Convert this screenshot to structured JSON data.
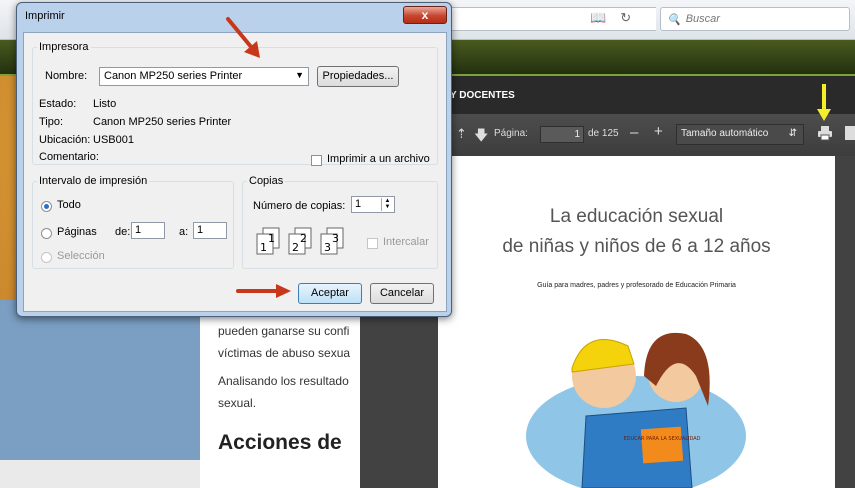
{
  "browser": {
    "search_placeholder": "Buscar"
  },
  "site": {
    "nav_text": "Y DOCENTES"
  },
  "pdf": {
    "page_label": "Página:",
    "page_value": "1",
    "page_total": "de 125",
    "zoom_label": "Tamaño automático",
    "title_line1": "La educación sexual",
    "title_line2": "de niñas y niños de 6 a 12 años",
    "subtitle": "Guía para madres, padres y profesorado de Educación Primaria",
    "book_text": "EDUCAR PARA LA SEXUALIDAD"
  },
  "article": {
    "line1": "pueden ganarse su confi",
    "line2": "víctimas de abuso sexua",
    "line3": "Analisando los resultado",
    "line4": "sexual.",
    "heading": "Acciones de"
  },
  "dialog": {
    "title": "Imprimir",
    "close_label": "x",
    "printer_group": "Impresora",
    "name_label": "Nombre:",
    "printer_name": "Canon MP250 series Printer",
    "properties_button": "Propiedades...",
    "status_label": "Estado:",
    "status_value": "Listo",
    "type_label": "Tipo:",
    "type_value": "Canon MP250 series Printer",
    "location_label": "Ubicación:",
    "location_value": "USB001",
    "comment_label": "Comentario:",
    "print_to_file": "Imprimir a un archivo",
    "range_group": "Intervalo de impresión",
    "all_option": "Todo",
    "pages_option": "Páginas",
    "from_label": "de:",
    "from_value": "1",
    "to_label": "a:",
    "to_value": "1",
    "selection_option": "Selección",
    "copies_group": "Copias",
    "copies_label": "Número de copias:",
    "copies_value": "1",
    "collate_label": "Intercalar",
    "collate_icon_digits": [
      "1",
      "1",
      "2",
      "2",
      "3",
      "3"
    ],
    "ok_button": "Aceptar",
    "cancel_button": "Cancelar"
  },
  "colors": {
    "annotation_red": "#c9371b",
    "annotation_yellow": "#f4ee2b"
  }
}
